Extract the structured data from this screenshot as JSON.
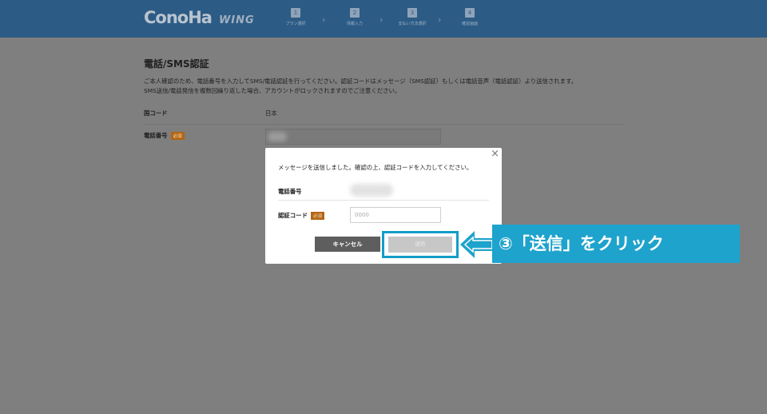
{
  "header": {
    "logo_main": "ConoHa",
    "logo_sub": "WING",
    "steps": [
      {
        "num": "1",
        "label": "プラン選択"
      },
      {
        "num": "2",
        "label": "情報入力"
      },
      {
        "num": "3",
        "label": "支払い方法選択"
      },
      {
        "num": "4",
        "label": "確認画面"
      }
    ]
  },
  "page": {
    "title": "電話/SMS認証",
    "description_line1": "ご本人確認のため、電話番号を入力してSMS/電話認証を行ってください。認証コードはメッセージ（SMS認証）もしくは電話音声（電話認証）より送信されます。",
    "description_line2": "SMS送信/電話発信を複数回繰り返した場合、アカウントがロックされますのでご注意ください。",
    "country_label": "国コード",
    "country_value": "日本",
    "phone_label": "電話番号",
    "required_badge": "必須"
  },
  "modal": {
    "close_glyph": "×",
    "message": "メッセージを送信しました。確認の上、認証コードを入力してください。",
    "phone_label": "電話番号",
    "code_label": "認証コード",
    "required_badge": "必須",
    "code_placeholder": "0000",
    "cancel_label": "キャンセル",
    "send_label": "送信"
  },
  "annotation": {
    "text": "③「送信」をクリック"
  },
  "colors": {
    "header_bg": "#2c5b85",
    "overlay_bg": "#7f7f7f",
    "callout_bg": "#1ea3cc",
    "badge_bg": "#b36512"
  }
}
